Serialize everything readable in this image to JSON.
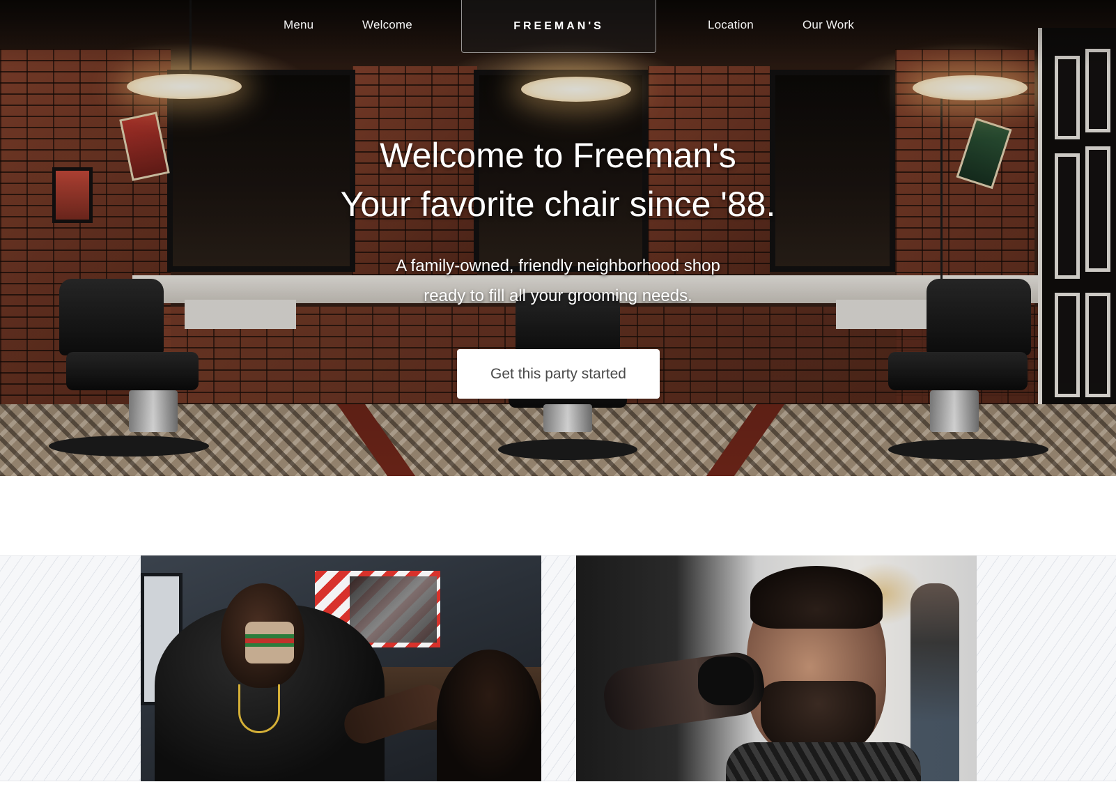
{
  "nav": {
    "links": {
      "menu": "Menu",
      "welcome": "Welcome",
      "location": "Location",
      "our_work": "Our Work"
    },
    "brand": "FREEMAN'S"
  },
  "hero": {
    "title_line1": "Welcome to Freeman's",
    "title_line2": "Your favorite chair since '88.",
    "subtitle_line1": "A family-owned, friendly neighborhood shop",
    "subtitle_line2": "ready to fill all your grooming needs.",
    "cta_label": "Get this party started",
    "background_image": "barbershop interior with brick walls, mirrors, pendant lamps and three barber chairs"
  },
  "gallery": {
    "photos": [
      {
        "name": "barber-with-mask-photo",
        "alt": "Barber wearing a patterned face mask cutting a client's hair"
      },
      {
        "name": "client-fade-haircut-photo",
        "alt": "Client with tattoos receiving a fade haircut"
      }
    ]
  },
  "colors": {
    "nav_text": "#f3f3f3",
    "brand_text": "#ffffff",
    "cta_background": "#ffffff",
    "cta_text": "#4a4a4a",
    "gallery_background": "#f6f7f9"
  }
}
